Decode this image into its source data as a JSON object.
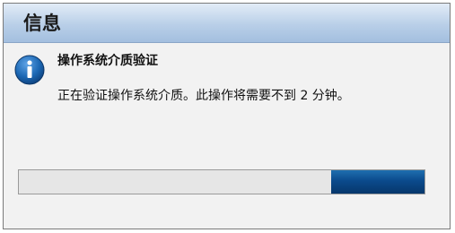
{
  "dialog": {
    "title": "信息",
    "icon": "info-icon",
    "heading": "操作系统介质验证",
    "message": "正在验证操作系统介质。此操作将需要不到 2 分钟。"
  },
  "progress": {
    "value": 0.23
  },
  "colors": {
    "titlebar": "#b9cfe8",
    "progress_fill": "#0b4a8c",
    "icon": "#1b67b3"
  }
}
